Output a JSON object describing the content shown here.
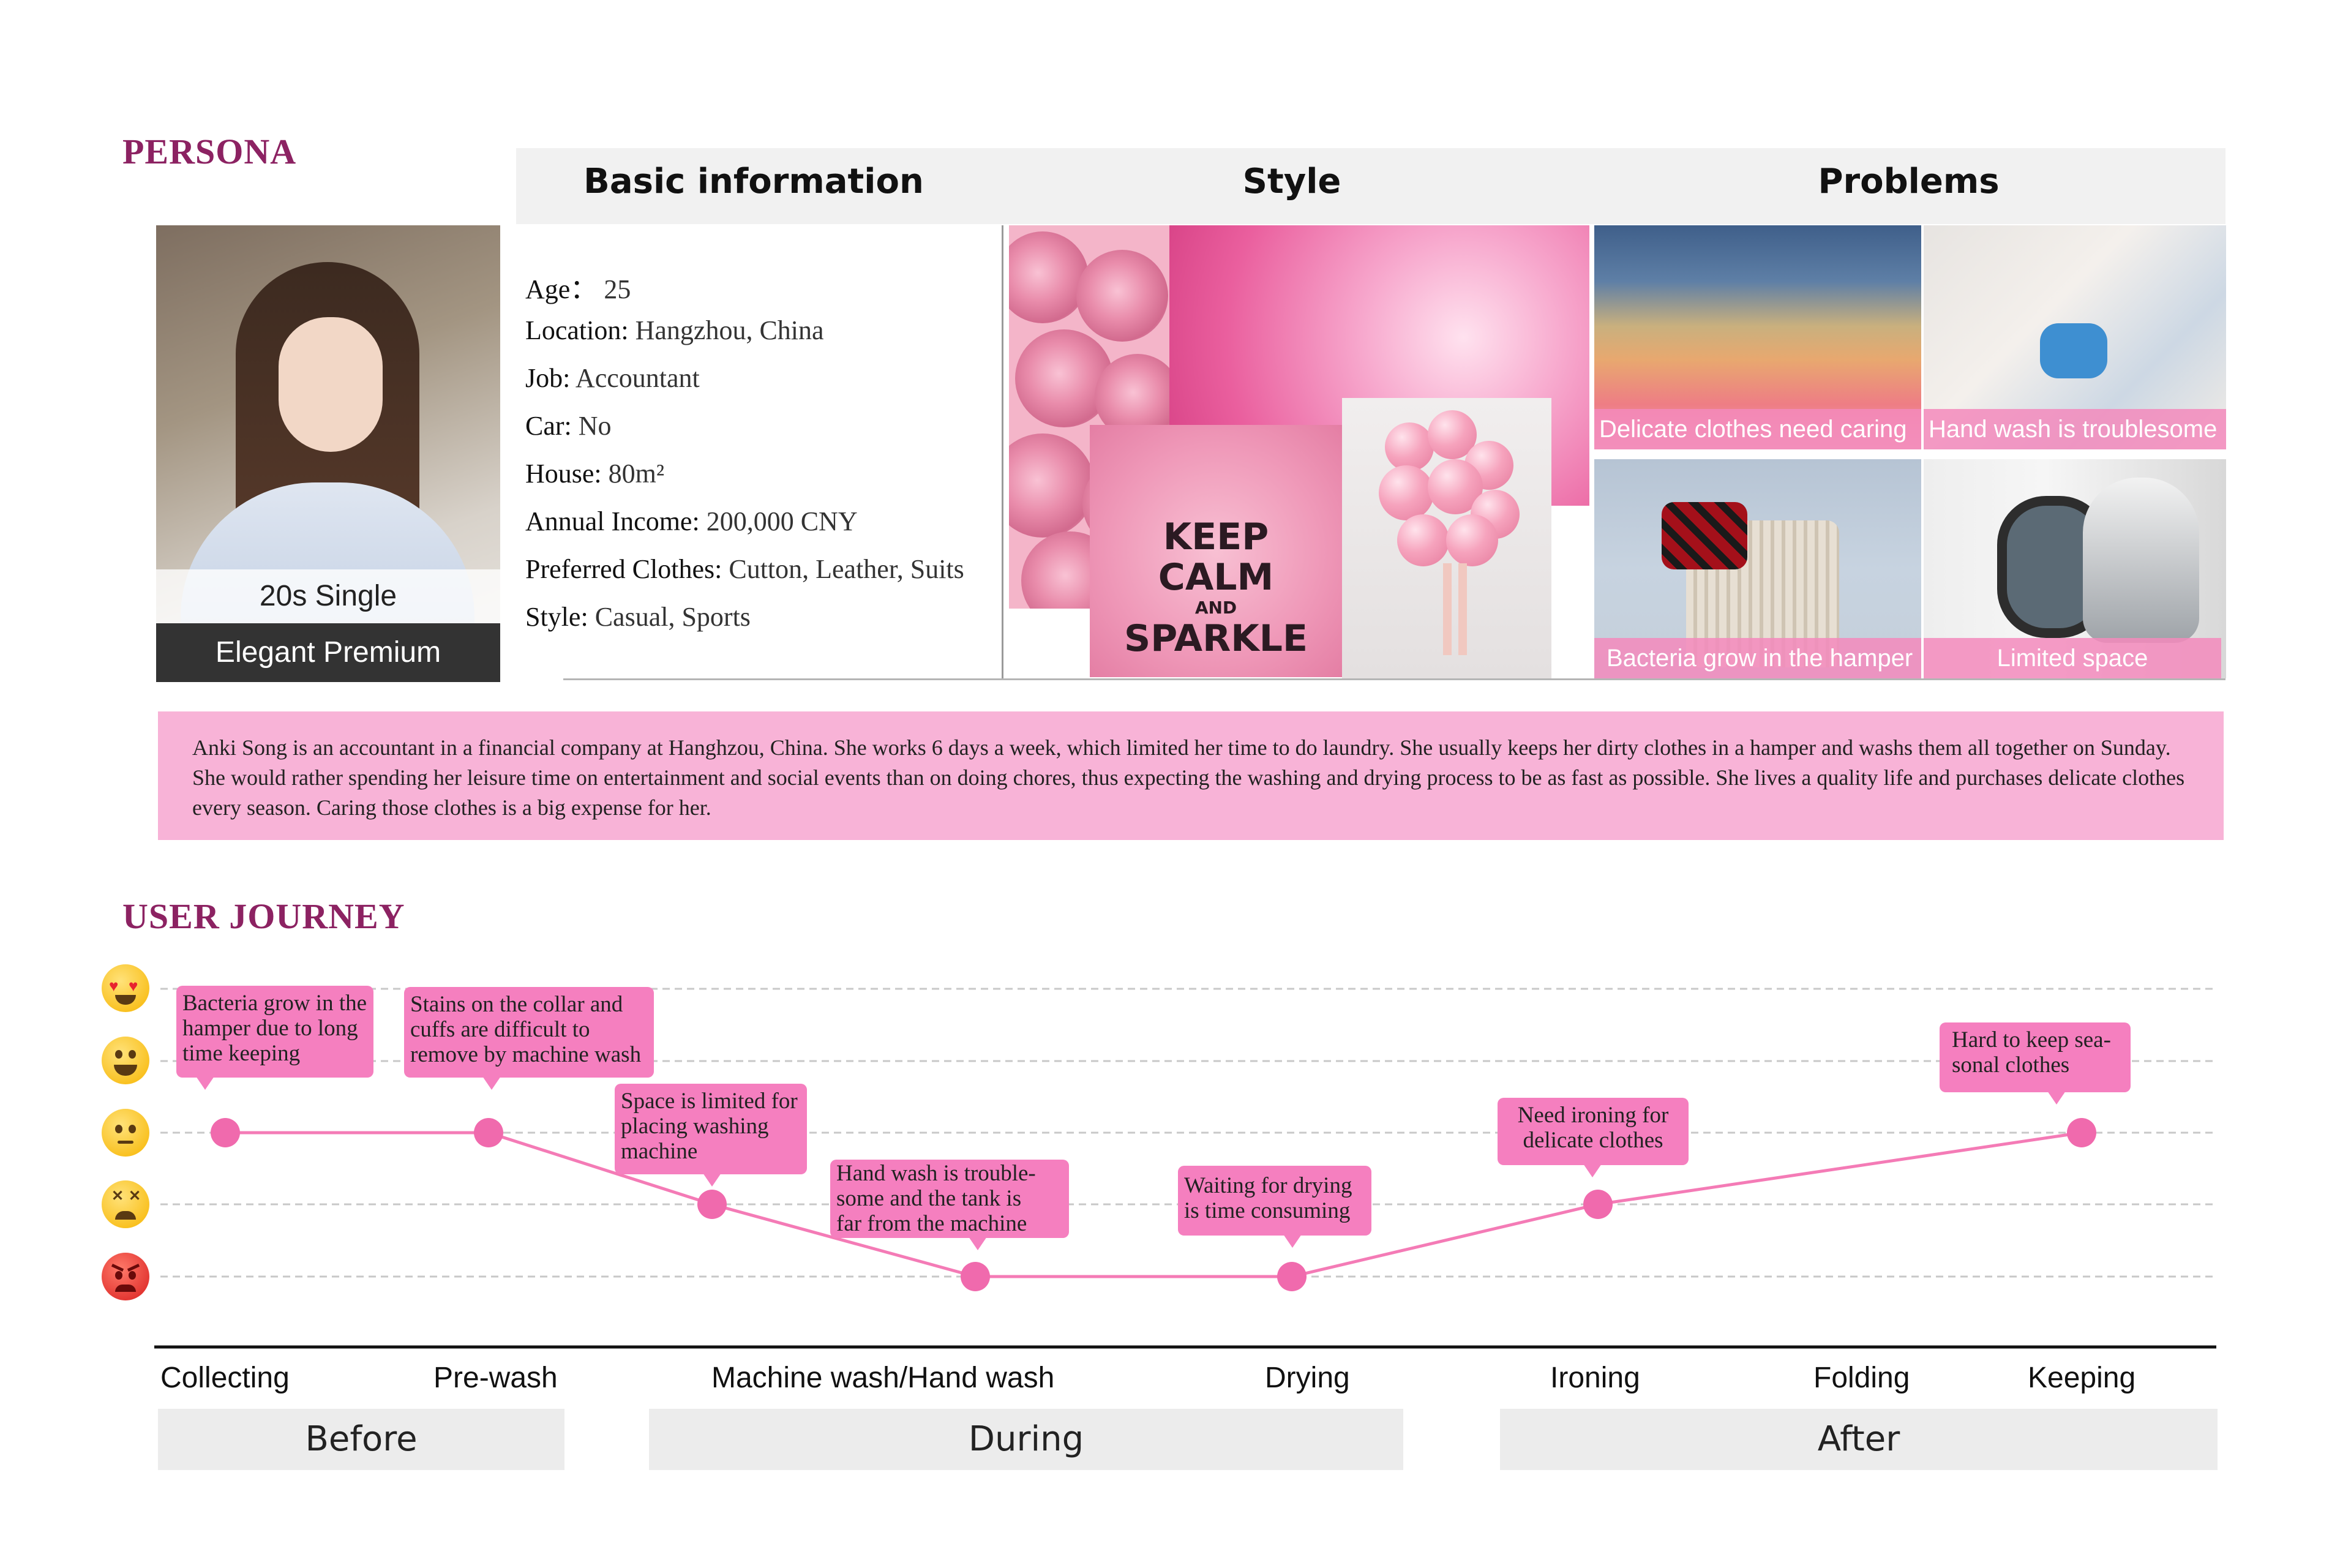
{
  "persona": {
    "section_title": "PERSONA",
    "columns": {
      "basic": "Basic information",
      "style": "Style",
      "problems": "Problems"
    },
    "tags": {
      "group": "20s Single",
      "segment": "Elegant Premium"
    },
    "info": [
      {
        "key": "Age：",
        "value": " 25"
      },
      {
        "key": "Location:",
        "value": " Hangzhou, China"
      },
      {
        "key": "Job:",
        "value": " Accountant"
      },
      {
        "key": "Car:",
        "value": " No"
      },
      {
        "key": "House:",
        "value": " 80m²"
      },
      {
        "key": "Annual Income:",
        "value": " 200,000 CNY"
      },
      {
        "key": "Preferred Clothes:",
        "value": " Cutton, Leather, Suits"
      },
      {
        "key": "Style:",
        "value": " Casual, Sports"
      }
    ],
    "style_poster": {
      "line1": "KEEP",
      "line2": "CALM",
      "line3": "AND",
      "line4": "SPARKLE"
    },
    "problems": [
      "Delicate clothes need caring",
      "Hand wash is troublesome",
      "Bacteria grow in the hamper",
      "Limited space"
    ],
    "description": "Anki Song is an accountant in a financial company at Hanghzou, China. She works 6 days a week, which limited  her time to do laundry. She usually keeps her dirty clothes in a hamper and washs them all together on Sunday.  She would rather spending her leisure time on entertainment and social events than on doing chores, thus expecting the washing and drying process to be as fast as possible. She lives a quality life and purchases delicate clothes every season. Caring those clothes is a big expense for her.",
    "colors": {
      "accent": "#8c2262",
      "pink": "#f8b3d7",
      "bubble": "#f57fbf",
      "line": "#f47bb6"
    }
  },
  "journey": {
    "section_title": "USER JOURNEY",
    "emotion_levels": [
      "heart-eyes",
      "happy",
      "neutral",
      "dizzy",
      "angry"
    ],
    "stages": [
      "Collecting",
      "Pre-wash",
      "Machine wash/Hand wash",
      "Drying",
      "Ironing",
      "Folding",
      "Keeping"
    ],
    "phases": [
      "Before",
      "During",
      "After"
    ],
    "points": [
      {
        "stage": "Collecting",
        "emotion_level": 3,
        "note": [
          "Bacteria grow in the",
          "hamper due to long",
          "time keeping"
        ]
      },
      {
        "stage": "Pre-wash",
        "emotion_level": 3,
        "note": [
          "Stains on the collar and",
          "cuffs are difficult to",
          "remove by machine wash"
        ]
      },
      {
        "stage": "Machine wash",
        "emotion_level": 2,
        "note": [
          "Space is limited for",
          "placing washing",
          "machine"
        ]
      },
      {
        "stage": "Hand wash",
        "emotion_level": 1,
        "note": [
          "Hand wash is trouble-",
          "some and the tank is",
          "far from the machine"
        ]
      },
      {
        "stage": "Drying",
        "emotion_level": 1,
        "note": [
          "Waiting for drying",
          "is time consuming"
        ]
      },
      {
        "stage": "Ironing",
        "emotion_level": 2,
        "note": [
          "Need ironing for",
          "delicate clothes"
        ]
      },
      {
        "stage": "Keeping",
        "emotion_level": 3,
        "note": [
          "Hard to keep sea-",
          "sonal clothes"
        ]
      }
    ]
  }
}
